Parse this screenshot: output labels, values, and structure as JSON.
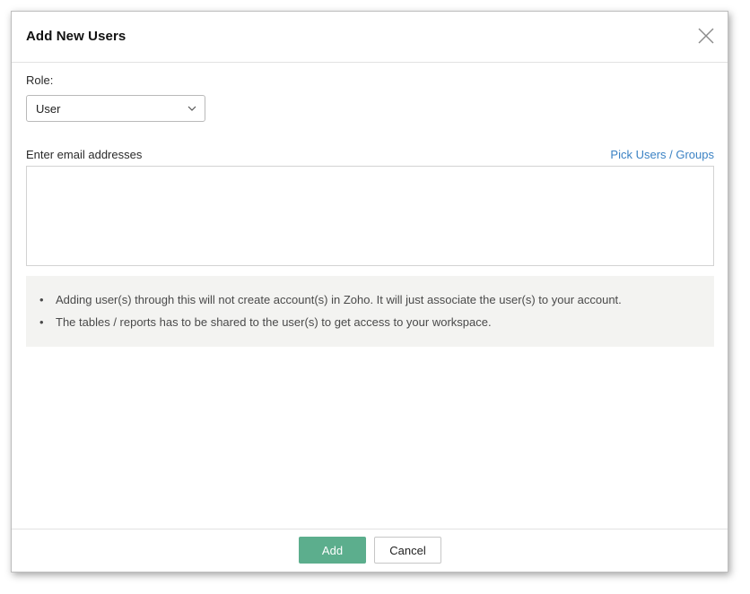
{
  "dialog": {
    "title": "Add New Users",
    "close_icon": "close-icon"
  },
  "role": {
    "label": "Role:",
    "selected": "User",
    "chevron_icon": "chevron-down-icon"
  },
  "emails": {
    "label": "Enter email addresses",
    "pick_link": "Pick Users / Groups",
    "value": "",
    "placeholder": ""
  },
  "info": {
    "bullet": "•",
    "items": [
      "Adding user(s) through this will not create account(s) in Zoho. It will just associate the user(s) to your account.",
      "The tables / reports has to be shared to the user(s) to get access to your workspace."
    ]
  },
  "footer": {
    "add_label": "Add",
    "cancel_label": "Cancel"
  },
  "colors": {
    "accent": "#5cae8d",
    "link": "#3b82c4",
    "info_bg": "#f3f3f1"
  }
}
